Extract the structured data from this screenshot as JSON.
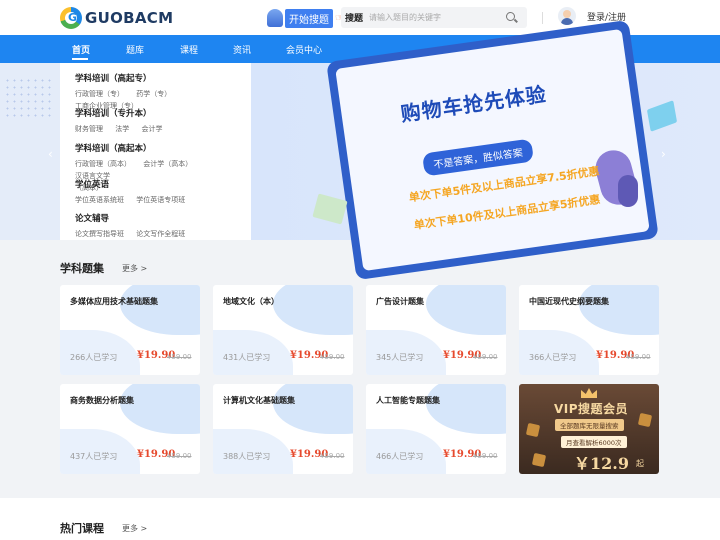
{
  "header": {
    "logo_text": "GUOBACM",
    "logo_letter": "G",
    "start_label": "开始搜题",
    "search_tag": "搜题",
    "search_placeholder": "请输入题目的关键字",
    "login": "登录/注册"
  },
  "nav": {
    "items": [
      "首页",
      "题库",
      "课程",
      "资讯",
      "会员中心"
    ]
  },
  "categories": [
    {
      "title": "学科培训（高起专）",
      "links": [
        "行政管理（专）",
        "药学（专）",
        "工商企业管理（专）"
      ]
    },
    {
      "title": "学科培训（专升本）",
      "links": [
        "财务管理",
        "法学",
        "会计学"
      ]
    },
    {
      "title": "学科培训（高起本）",
      "links": [
        "行政管理（高本）",
        "会计学（高本）",
        "汉语言文学",
        "（高本）"
      ]
    },
    {
      "title": "学位英语",
      "links": [
        "学位英语系统班",
        "学位英语专项班"
      ]
    },
    {
      "title": "论文辅导",
      "links": [
        "论文撰写指导班",
        "论文写作全程班"
      ]
    }
  ],
  "banner": {
    "title": "购物车抢先体验",
    "pill": "不是答案，胜似答案",
    "line1": "单次下单5件及以上商品立享7.5折优惠",
    "line2": "单次下单10件及以上商品立享5折优惠",
    "prev": "‹",
    "next": "›"
  },
  "section1": {
    "title": "学科题集",
    "more": "更多 >"
  },
  "cards": [
    {
      "title": "多媒体应用技术基础题集",
      "learners": "266人已学习",
      "price": "¥19.90",
      "orig": "¥59.00"
    },
    {
      "title": "地域文化（本）",
      "learners": "431人已学习",
      "price": "¥19.90",
      "orig": "¥59.00"
    },
    {
      "title": "广告设计题集",
      "learners": "345人已学习",
      "price": "¥19.90",
      "orig": "¥59.00"
    },
    {
      "title": "中国近现代史纲要题集",
      "learners": "366人已学习",
      "price": "¥19.90",
      "orig": "¥59.00"
    },
    {
      "title": "商务数据分析题集",
      "learners": "437人已学习",
      "price": "¥19.90",
      "orig": "¥59.00"
    },
    {
      "title": "计算机文化基础题集",
      "learners": "388人已学习",
      "price": "¥19.90",
      "orig": "¥59.00"
    },
    {
      "title": "人工智能专题题集",
      "learners": "466人已学习",
      "price": "¥19.90",
      "orig": "¥59.00"
    }
  ],
  "vip": {
    "title": "VIP搜题会员",
    "badge": "全部题库无限量搜索",
    "sub": "月查看解析6000次",
    "price": "￥12.9",
    "unit": "起"
  },
  "section2": {
    "title": "热门课程",
    "more": "更多 >"
  }
}
